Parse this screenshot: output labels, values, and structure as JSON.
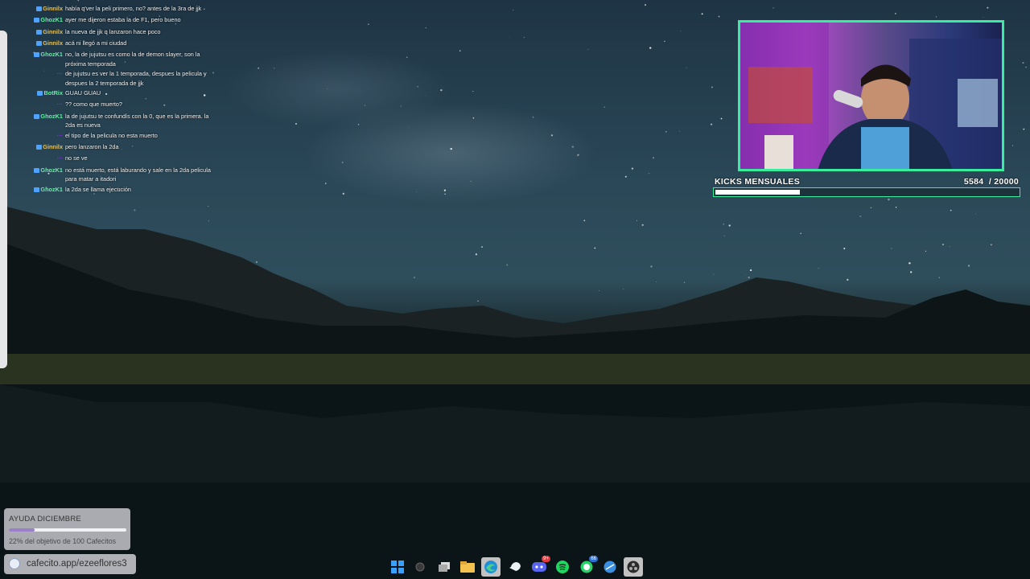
{
  "chat": [
    {
      "user": "Ginnilx",
      "color": "#e0c060",
      "badge": true,
      "text": "había q'ver la peli primero, no? antes de la 3ra de jjk"
    },
    {
      "user": "GhozK1",
      "color": "#5ff2a0",
      "badge": true,
      "text": "ayer me dijeron estaba la de F1, pero bueno"
    },
    {
      "user": "Ginnilx",
      "color": "#e0c060",
      "badge": true,
      "text": "la nueva de jjk q lanzaron hace poco"
    },
    {
      "user": "Ginnilx",
      "color": "#e0c060",
      "badge": true,
      "text": "acá ni llegó a mi ciudad"
    },
    {
      "user": "GhozK1",
      "color": "#5ff2a0",
      "badge": true,
      "text": "no, la de jujutsu es como la de demon slayer, son la próxima temporada"
    },
    {
      "user": "···",
      "color": "#7a3ad6",
      "badge": false,
      "text": "de jujutsu es ver la 1 temporada, despues la pelicula y despues la 2 temporada de jjk"
    },
    {
      "user": "BotRix",
      "color": "#5ff2a0",
      "badge": true,
      "text": "GUAU GUAU"
    },
    {
      "user": "···",
      "color": "#7a3ad6",
      "badge": false,
      "text": "?? como que muerto?"
    },
    {
      "user": "GhozK1",
      "color": "#5ff2a0",
      "badge": true,
      "text": "la de jujutsu te confundís con la 0, que es la primera. la 2da es nueva"
    },
    {
      "user": "···",
      "color": "#7a3ad6",
      "badge": false,
      "text": "el tipo de la pelicula no esta muerto"
    },
    {
      "user": "Ginnilx",
      "color": "#e0c060",
      "badge": true,
      "text": "pero lanzaron la 2da"
    },
    {
      "user": "···",
      "color": "#7a3ad6",
      "badge": false,
      "text": "no se ve"
    },
    {
      "user": "GhozK1",
      "color": "#5ff2a0",
      "badge": true,
      "text": "no está muerto, está laburando y sale en la 2da pelicula para matar a itadori"
    },
    {
      "user": "GhozK1",
      "color": "#5ff2a0",
      "badge": true,
      "text": "la 2da se llama ejecución"
    }
  ],
  "goal": {
    "label": "KICKS MENSUALES",
    "current": "5584",
    "target": "/ 20000",
    "progress": 0.279
  },
  "donation": {
    "title": "AYUDA DICIEMBRE",
    "subtitle": "22% del objetivo de 100 Cafecitos",
    "progress": 0.22
  },
  "cafecito": {
    "url": "cafecito.app/ezeeflores3"
  },
  "taskbar": [
    {
      "name": "windows-start-icon"
    },
    {
      "name": "search-icon"
    },
    {
      "name": "task-view-icon"
    },
    {
      "name": "file-explorer-icon"
    },
    {
      "name": "edge-icon"
    },
    {
      "name": "steam-icon"
    },
    {
      "name": "discord-icon",
      "badge": "9+"
    },
    {
      "name": "spotify-icon"
    },
    {
      "name": "whatsapp-icon",
      "badge": "66"
    },
    {
      "name": "browser-icon"
    },
    {
      "name": "obs-icon"
    }
  ],
  "colors": {
    "accent": "#38ee9e",
    "chat_text": "#f2f2f2",
    "taskbar_active": "#c2c2c2"
  }
}
